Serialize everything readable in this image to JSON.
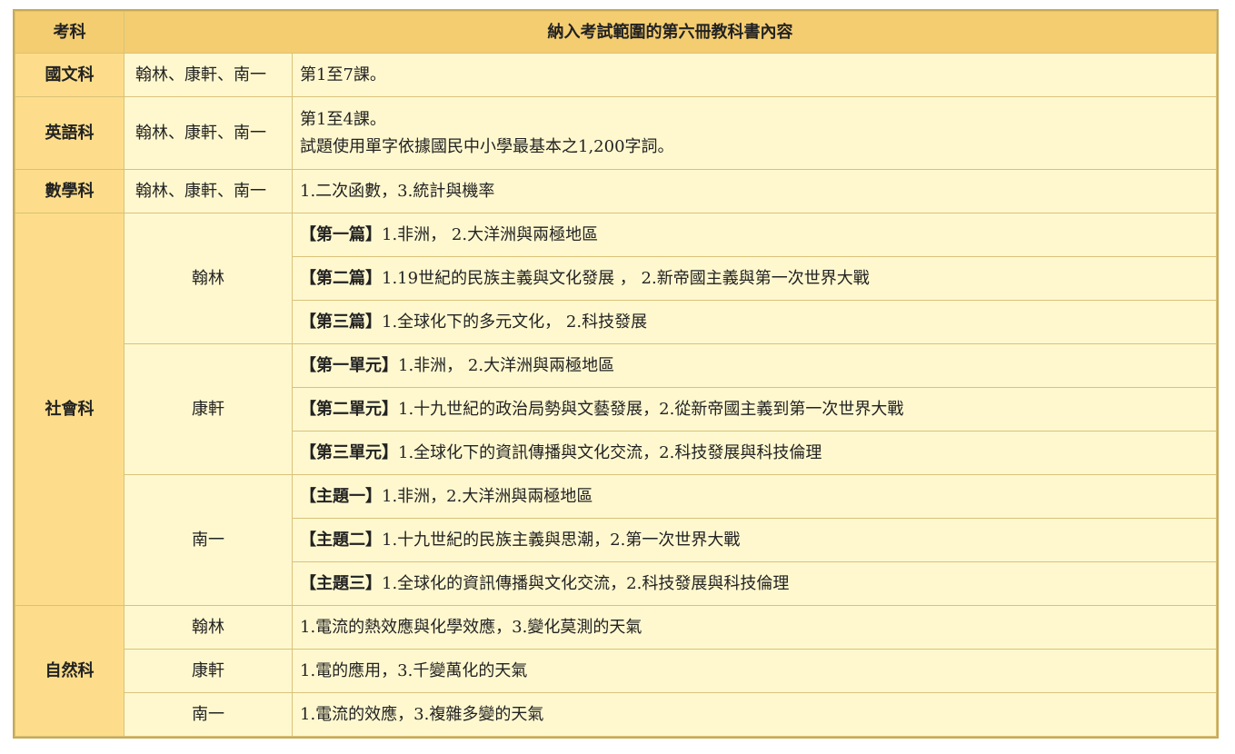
{
  "header": {
    "col_subject": "考科",
    "col_content": "納入考試範圍的第六冊教科書內容"
  },
  "chinese": {
    "subject": "國文科",
    "publishers": "翰林、康軒、南一",
    "content": "第1至7課。"
  },
  "english": {
    "subject": "英語科",
    "publishers": "翰林、康軒、南一",
    "line1": "第1至4課。",
    "line2": "試題使用單字依據國民中小學最基本之1,200字詞。"
  },
  "math": {
    "subject": "數學科",
    "publishers": "翰林、康軒、南一",
    "content": "1.二次函數，3.統計與機率"
  },
  "social": {
    "subject": "社會科",
    "groups": [
      {
        "publisher": "翰林",
        "items": [
          {
            "tag": "【第一篇】",
            "text": "1.非洲， 2.大洋洲與兩極地區"
          },
          {
            "tag": "【第二篇】",
            "text": "1.19世紀的民族主義與文化發展 ， 2.新帝國主義與第一次世界大戰"
          },
          {
            "tag": "【第三篇】",
            "text": "1.全球化下的多元文化， 2.科技發展"
          }
        ]
      },
      {
        "publisher": "康軒",
        "items": [
          {
            "tag": "【第一單元】",
            "text": "1.非洲， 2.大洋洲與兩極地區"
          },
          {
            "tag": "【第二單元】",
            "text": "1.十九世紀的政治局勢與文藝發展，2.從新帝國主義到第一次世界大戰"
          },
          {
            "tag": "【第三單元】",
            "text": "1.全球化下的資訊傳播與文化交流，2.科技發展與科技倫理"
          }
        ]
      },
      {
        "publisher": "南一",
        "items": [
          {
            "tag": "【主題一】",
            "text": "1.非洲，2.大洋洲與兩極地區"
          },
          {
            "tag": "【主題二】",
            "text": "1.十九世紀的民族主義與思潮，2.第一次世界大戰"
          },
          {
            "tag": "【主題三】",
            "text": "1.全球化的資訊傳播與文化交流，2.科技發展與科技倫理"
          }
        ]
      }
    ]
  },
  "science": {
    "subject": "自然科",
    "rows": [
      {
        "publisher": "翰林",
        "content": "1.電流的熱效應與化學效應，3.變化莫測的天氣"
      },
      {
        "publisher": "康軒",
        "content": "1.電的應用，3.千變萬化的天氣"
      },
      {
        "publisher": "南一",
        "content": "1.電流的效應，3.複雜多變的天氣"
      }
    ]
  }
}
